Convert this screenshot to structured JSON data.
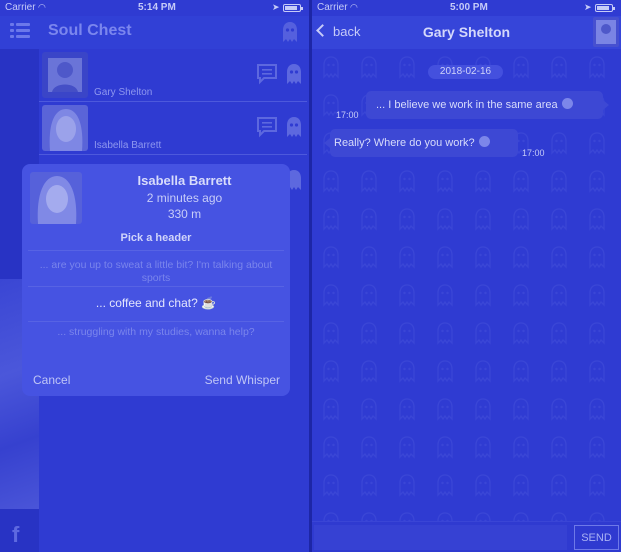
{
  "left_screen": {
    "status": {
      "carrier": "Carrier",
      "time": "5:14 PM"
    },
    "nav": {
      "title": "Soul Chest"
    },
    "list": [
      {
        "name": "Gary Shelton"
      },
      {
        "name": "Isabella Barrett"
      }
    ],
    "dialog": {
      "name": "Isabella Barrett",
      "time_ago": "2 minutes ago",
      "distance": "330 m",
      "pick_label": "Pick a header",
      "options": [
        {
          "text": "... are you up to sweat a little bit? I'm talking about sports"
        },
        {
          "text": "... coffee and chat? ☕"
        },
        {
          "text": "... struggling with my studies, wanna help?"
        }
      ],
      "cancel_label": "Cancel",
      "send_label": "Send Whisper"
    },
    "footer_icon": "facebook-icon"
  },
  "right_screen": {
    "status": {
      "carrier": "Carrier",
      "time": "5:00 PM"
    },
    "nav": {
      "back_label": "back",
      "title": "Gary Shelton"
    },
    "date_pill": "2018-02-16",
    "messages": [
      {
        "direction": "out",
        "text": "... I believe we work in the same area",
        "time": "17:00"
      },
      {
        "direction": "in",
        "text": "Really? Where do you work?",
        "time": "17:00"
      }
    ],
    "input": {
      "placeholder": "",
      "send_label": "SEND"
    }
  },
  "colors": {
    "background": "#2f3bd2",
    "accent": "#4653e2",
    "bubble": "#3d48d4"
  }
}
